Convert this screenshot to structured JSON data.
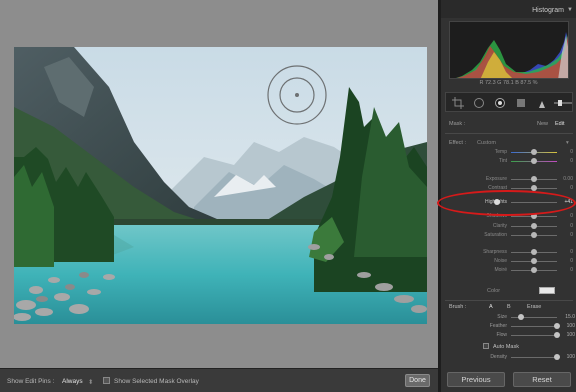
{
  "panel": {
    "histogram_title": "Histogram",
    "histogram_menu_icon": "triangle-down-icon",
    "readout": "R 72.3   G 78.1   B 87.5 %",
    "tools": [
      "crop-icon",
      "spot-removal-icon",
      "red-eye-icon",
      "graduated-filter-icon",
      "adjustment-brush-icon",
      "slider-icon"
    ],
    "mask": {
      "label": "Mask :",
      "new": "New",
      "edit": "Edit"
    },
    "effect": {
      "label": "Effect :",
      "value": "Custom"
    },
    "color_label": "Color",
    "sliders": [
      {
        "label": "Temp",
        "value": "0"
      },
      {
        "label": "Tint",
        "value": "0"
      },
      {
        "label": "Exposure",
        "value": "0.00"
      },
      {
        "label": "Contrast",
        "value": "0"
      },
      {
        "label": "Highlights",
        "value": "+41",
        "highlighted": true
      },
      {
        "label": "Shadows",
        "value": "0"
      },
      {
        "label": "Clarity",
        "value": "0"
      },
      {
        "label": "Saturation",
        "value": "0"
      },
      {
        "label": "Sharpness",
        "value": "0"
      },
      {
        "label": "Noise",
        "value": "0"
      },
      {
        "label": "Moiré",
        "value": "0"
      }
    ],
    "brush": {
      "label": "Brush :",
      "a": "A",
      "b": "B",
      "erase": "Erase",
      "size": {
        "label": "Size",
        "value": "15.0"
      },
      "feather": {
        "label": "Feather",
        "value": "100"
      },
      "flow": {
        "label": "Flow",
        "value": "100"
      },
      "auto_mask": "Auto Mask",
      "density": {
        "label": "Density",
        "value": "100"
      }
    },
    "previous": "Previous",
    "reset": "Reset"
  },
  "toolbar": {
    "show_edit_pins_label": "Show Edit Pins :",
    "show_edit_pins_value": "Always",
    "overlay_label": "Show Selected Mask Overlay",
    "done": "Done"
  },
  "colors": {
    "highlight_ring": "#d61a1a",
    "water": "#3fb3b8"
  }
}
